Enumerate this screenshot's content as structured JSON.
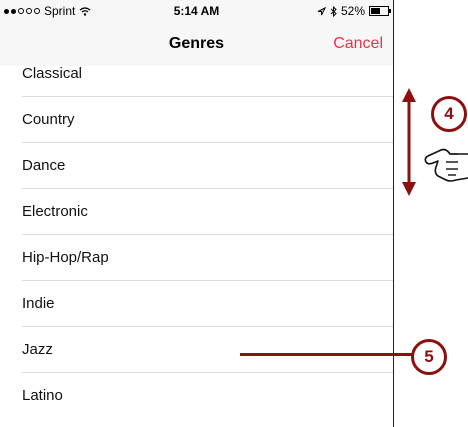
{
  "statusbar": {
    "carrier": "Sprint",
    "time": "5:14 AM",
    "battery": "52%"
  },
  "navbar": {
    "title": "Genres",
    "cancel_label": "Cancel"
  },
  "genres": [
    "Classical",
    "Country",
    "Dance",
    "Electronic",
    "Hip-Hop/Rap",
    "Indie",
    "Jazz",
    "Latino"
  ],
  "callouts": {
    "scroll_step": "4",
    "select_step": "5"
  },
  "colors": {
    "accent": "#e8334a",
    "callout": "#8b1010"
  }
}
